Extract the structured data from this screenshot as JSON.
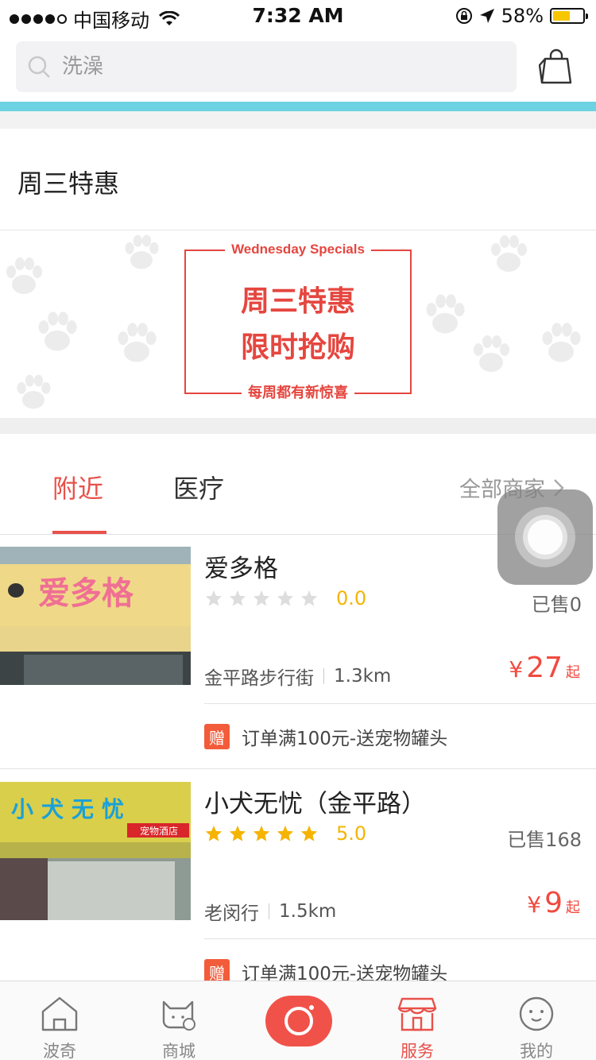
{
  "status_bar": {
    "carrier": "中国移动",
    "time": "7:32 AM",
    "battery": "58%",
    "battery_level": 0.58
  },
  "search": {
    "placeholder": "洗澡"
  },
  "section_title": "周三特惠",
  "banner": {
    "en": "Wednesday Specials",
    "line1": "周三特惠",
    "line2": "限时抢购",
    "footer": "每周都有新惊喜"
  },
  "tabs": {
    "nearby": "附近",
    "medical": "医疗",
    "all_merchants": "全部商家"
  },
  "shops": [
    {
      "name": "爱多格",
      "rating": "0.0",
      "rating_value": 0,
      "sold": "已售0",
      "area": "金平路步行街",
      "distance": "1.3km",
      "yen": "¥",
      "price": "27",
      "qi": "起",
      "promo_badge": "赠",
      "promo": "订单满100元-送宠物罐头",
      "sign_text": "爱多格"
    },
    {
      "name": "小犬无忧（金平路）",
      "rating": "5.0",
      "rating_value": 5,
      "sold": "已售168",
      "area": "老闵行",
      "distance": "1.5km",
      "yen": "¥",
      "price": "9",
      "qi": "起",
      "promo_badge": "赠",
      "promo": "订单满100元-送宠物罐头",
      "sign_text": "小犬无忧",
      "sign_sub": "宠物酒店"
    }
  ],
  "tabbar": {
    "items": [
      {
        "label": "波奇",
        "icon": "home-icon"
      },
      {
        "label": "商城",
        "icon": "cat-shop-icon"
      },
      {
        "label": "",
        "icon": "camera-icon"
      },
      {
        "label": "服务",
        "icon": "store-icon"
      },
      {
        "label": "我的",
        "icon": "profile-icon"
      }
    ]
  },
  "colors": {
    "accent": "#e8514a",
    "star_on": "#f5b400",
    "star_off": "#dddddd",
    "teal": "#6dd2e1"
  }
}
